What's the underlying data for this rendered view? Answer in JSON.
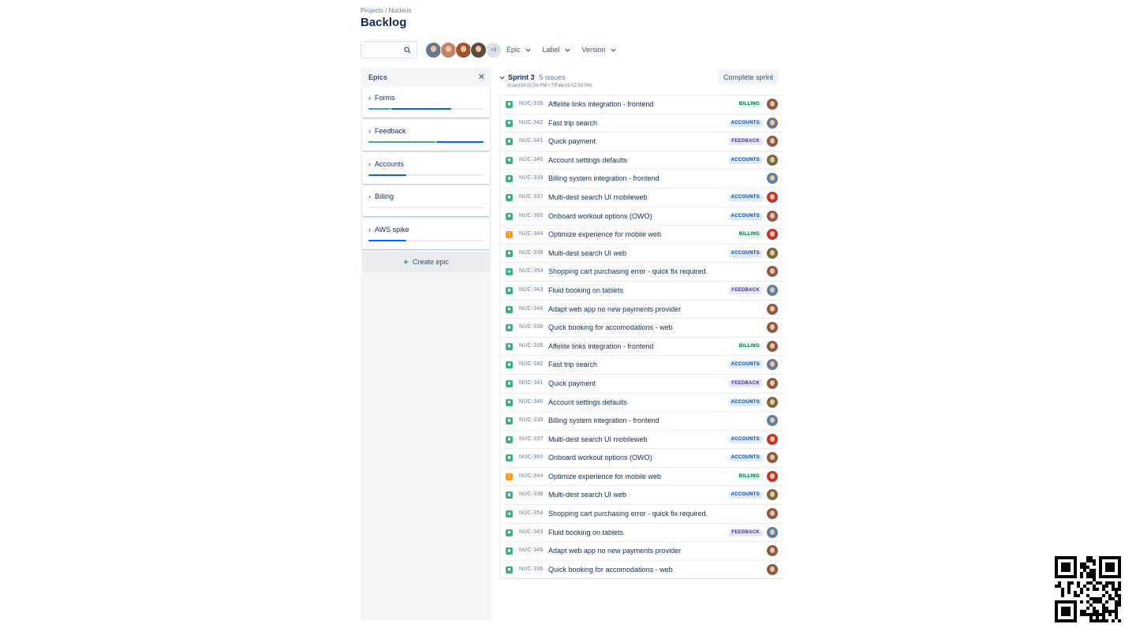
{
  "breadcrumb": "Projects / Nucleus",
  "title": "Backlog",
  "search": {
    "placeholder": ""
  },
  "avatars": {
    "colors": [
      "#6b778c",
      "#c1846a",
      "#a0522d",
      "#5e4b3c"
    ],
    "more_label": "+3"
  },
  "filters": [
    "Epic",
    "Label",
    "Version"
  ],
  "epics_panel": {
    "heading": "Epics",
    "close_icon": "close-icon",
    "epics": [
      {
        "name": "Forms",
        "progress": [
          {
            "color": "#36b37e",
            "fraction": 0.19
          },
          {
            "color": "#0065ff",
            "fraction": 0.52
          }
        ]
      },
      {
        "name": "Feedback",
        "progress": [
          {
            "color": "#36b37e",
            "fraction": 0.58
          },
          {
            "color": "#0065ff",
            "fraction": 0.41
          }
        ]
      },
      {
        "name": "Accounts",
        "progress": [
          {
            "color": "#0065ff",
            "fraction": 0.33
          }
        ]
      },
      {
        "name": "Billing",
        "progress": []
      },
      {
        "name": "AWS spike",
        "progress": [
          {
            "color": "#0065ff",
            "fraction": 0.33
          }
        ]
      }
    ],
    "create_label": "Create epic"
  },
  "sprint": {
    "name": "Sprint 3",
    "count": "5 issues",
    "dates": "3/Jan/19 02:59 PM • 7/Feb/19 02:59 PM",
    "complete_label": "Complete sprint",
    "issues": [
      {
        "type": "story",
        "key": "NUC-335",
        "summary": "Affelite links integration - frontend",
        "label": "BILLING",
        "avatar": "#8d5a44"
      },
      {
        "type": "story",
        "key": "NUC-342",
        "summary": "Fast trip search",
        "label": "ACCOUNTS",
        "avatar": "#6b778c"
      },
      {
        "type": "story",
        "key": "NUC-341",
        "summary": "Quick payment",
        "label": "FEEDBACK",
        "avatar": "#8d5a44"
      },
      {
        "type": "story",
        "key": "NUC-340",
        "summary": "Account settings defaults",
        "label": "ACCOUNTS",
        "avatar": "#7a6a3a"
      },
      {
        "type": "story",
        "key": "NUC-339",
        "summary": "Billing system integration - frontend",
        "label": "",
        "avatar": "#5b7fa6"
      },
      {
        "type": "story",
        "key": "NUC-337",
        "summary": "Multi-dest search UI mobileweb",
        "label": "ACCOUNTS",
        "avatar": "#c1352f"
      },
      {
        "type": "story",
        "key": "NUC-360",
        "summary": "Onboard workout options (OWO)",
        "label": "ACCOUNTS",
        "avatar": "#8d5a44"
      },
      {
        "type": "bug",
        "key": "NUC-344",
        "summary": "Optimize experience for mobile web",
        "label": "BILLING",
        "avatar": "#c1352f"
      },
      {
        "type": "story",
        "key": "NUC-338",
        "summary": "Multi-dest search UI web",
        "label": "ACCOUNTS",
        "avatar": "#7a6a3a"
      },
      {
        "type": "plus",
        "key": "NUC-354",
        "summary": "Shopping cart purchasing error - quick fix required.",
        "label": "",
        "avatar": "#8d5a44"
      },
      {
        "type": "story",
        "key": "NUC-343",
        "summary": "Fluid booking on tablets",
        "label": "FEEDBACK",
        "avatar": "#5b7fa6"
      },
      {
        "type": "story",
        "key": "NUC-346",
        "summary": "Adapt web app no new payments provider",
        "label": "",
        "avatar": "#8d5a44"
      },
      {
        "type": "story",
        "key": "NUC-336",
        "summary": "Quick booking for accomodations - web",
        "label": "",
        "avatar": "#8d5a44"
      },
      {
        "type": "story",
        "key": "NUC-335",
        "summary": "Affelite links integration - frontend",
        "label": "BILLING",
        "avatar": "#8d5a44"
      },
      {
        "type": "story",
        "key": "NUC-342",
        "summary": "Fast trip search",
        "label": "ACCOUNTS",
        "avatar": "#6b778c"
      },
      {
        "type": "story",
        "key": "NUC-341",
        "summary": "Quick payment",
        "label": "FEEDBACK",
        "avatar": "#8d5a44"
      },
      {
        "type": "story",
        "key": "NUC-340",
        "summary": "Account settings defaults",
        "label": "ACCOUNTS",
        "avatar": "#7a6a3a"
      },
      {
        "type": "story",
        "key": "NUC-339",
        "summary": "Billing system integration - frontend",
        "label": "",
        "avatar": "#5b7fa6"
      },
      {
        "type": "story",
        "key": "NUC-337",
        "summary": "Multi-dest search UI mobileweb",
        "label": "ACCOUNTS",
        "avatar": "#c1352f"
      },
      {
        "type": "story",
        "key": "NUC-360",
        "summary": "Onboard workout options (OWO)",
        "label": "ACCOUNTS",
        "avatar": "#8d5a44"
      },
      {
        "type": "bug",
        "key": "NUC-344",
        "summary": "Optimize experience for mobile web",
        "label": "BILLING",
        "avatar": "#c1352f"
      },
      {
        "type": "story",
        "key": "NUC-338",
        "summary": "Multi-dest search UI web",
        "label": "ACCOUNTS",
        "avatar": "#7a6a3a"
      },
      {
        "type": "plus",
        "key": "NUC-354",
        "summary": "Shopping cart purchasing error - quick fix required.",
        "label": "",
        "avatar": "#8d5a44"
      },
      {
        "type": "story",
        "key": "NUC-343",
        "summary": "Fluid booking on tablets",
        "label": "FEEDBACK",
        "avatar": "#5b7fa6"
      },
      {
        "type": "story",
        "key": "NUC-346",
        "summary": "Adapt web app no new payments provider",
        "label": "",
        "avatar": "#8d5a44"
      },
      {
        "type": "story",
        "key": "NUC-336",
        "summary": "Quick booking for accomodations - web",
        "label": "",
        "avatar": "#8d5a44"
      }
    ]
  },
  "qr_code": "qr-code-icon"
}
